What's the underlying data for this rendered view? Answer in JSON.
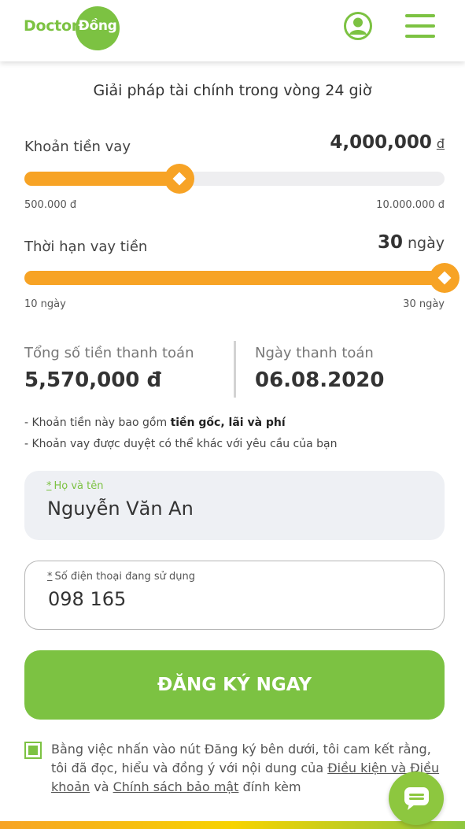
{
  "header": {
    "logo_text_left": "Doctor",
    "logo_text_right": "Đồng",
    "user_icon": "user-circle-icon",
    "menu_icon": "hamburger-menu-icon"
  },
  "tagline": "Giải pháp tài chính trong vòng 24 giờ",
  "loan_amount": {
    "label": "Khoản tiền vay",
    "value": "4,000,000",
    "unit": "đ",
    "min_label": "500.000 đ",
    "max_label": "10.000.000 đ",
    "min": 500000,
    "max": 10000000,
    "current": 4000000
  },
  "loan_term": {
    "label": "Thời hạn vay tiền",
    "value": "30",
    "unit": "ngày",
    "min_label": "10 ngày",
    "max_label": "30 ngày",
    "min": 10,
    "max": 30,
    "current": 30
  },
  "summary": {
    "total_label": "Tổng số tiền thanh toán",
    "total_value": "5,570,000 đ",
    "date_label": "Ngày thanh toán",
    "date_value": "06.08.2020"
  },
  "notes": {
    "line1_prefix": "- Khoản tiền này bao gồm ",
    "line1_bold": "tiền gốc, lãi và phí",
    "line2": "- Khoản vay được duyệt có thể khác với yêu cầu của bạn"
  },
  "form": {
    "name_label_star": "*",
    "name_label": "Họ và tên",
    "name_value": "Nguyễn Văn An",
    "phone_label_star": "*",
    "phone_label": "Số điện thoại đang sử dụng",
    "phone_value": "098 165"
  },
  "cta_label": "ĐĂNG KÝ NGAY",
  "consent": {
    "checked": true,
    "text_before": "Bằng việc nhấn vào nút Đăng ký bên dưới, tôi cam kết rằng, tôi đã đọc, hiểu và đồng ý với nội dung của ",
    "link_terms": "Điều kiện và Điều khoản",
    "text_middle": " và ",
    "link_privacy": "Chính sách bảo mật",
    "text_after": " đính kèm"
  },
  "chat_icon": "chat-bubble-icon",
  "colors": {
    "brand_green": "#7cc242",
    "slider_orange": "#f7a325",
    "field_bg": "#eef0f4"
  }
}
